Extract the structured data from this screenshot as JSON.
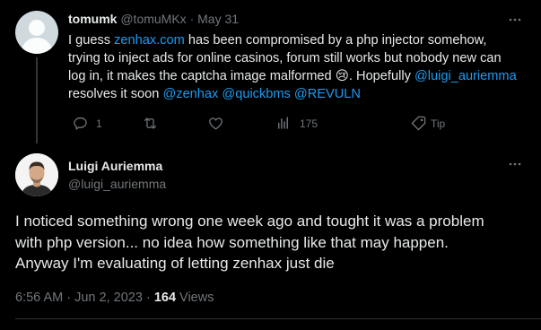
{
  "colors": {
    "background": "#000000",
    "text": "#e7e9ea",
    "muted": "#71767b",
    "link": "#1d9bf0",
    "divider": "#2f3336"
  },
  "reply_to": {
    "display_name": "tomumk",
    "handle": "@tomuMKx",
    "separator": "·",
    "date": "May 31",
    "more_icon": "more-horizontal-icon",
    "text_parts": {
      "p1": "I guess ",
      "link1": "zenhax.com",
      "p2": " has been compromised by a php injector somehow, trying to inject ads for online casinos, forum still works but nobody new can log in, it makes the captcha image malformed ",
      "emoji": "😢",
      "p3": ". Hopefully ",
      "mention1": "@luigi_auriemma",
      "p4": " resolves it soon ",
      "mention2": "@zenhax",
      "mention3": "@quickbms",
      "mention4": "@REVULN"
    },
    "actions": {
      "reply_count": "1",
      "retweet_count": "",
      "like_count": "",
      "views_count": "175",
      "tip_label": "Tip"
    }
  },
  "main_tweet": {
    "display_name": "Luigi Auriemma",
    "handle": "@luigi_auriemma",
    "more_icon": "more-horizontal-icon",
    "text_lines": [
      "I noticed something wrong one week ago and tought it was a problem",
      "with php version... no idea how something like that may happen.",
      "Anyway I'm evaluating of letting zenhax just die"
    ],
    "time": "6:56 AM",
    "separator": "·",
    "date": "Jun 2, 2023",
    "views_count": "164",
    "views_label": "Views"
  }
}
